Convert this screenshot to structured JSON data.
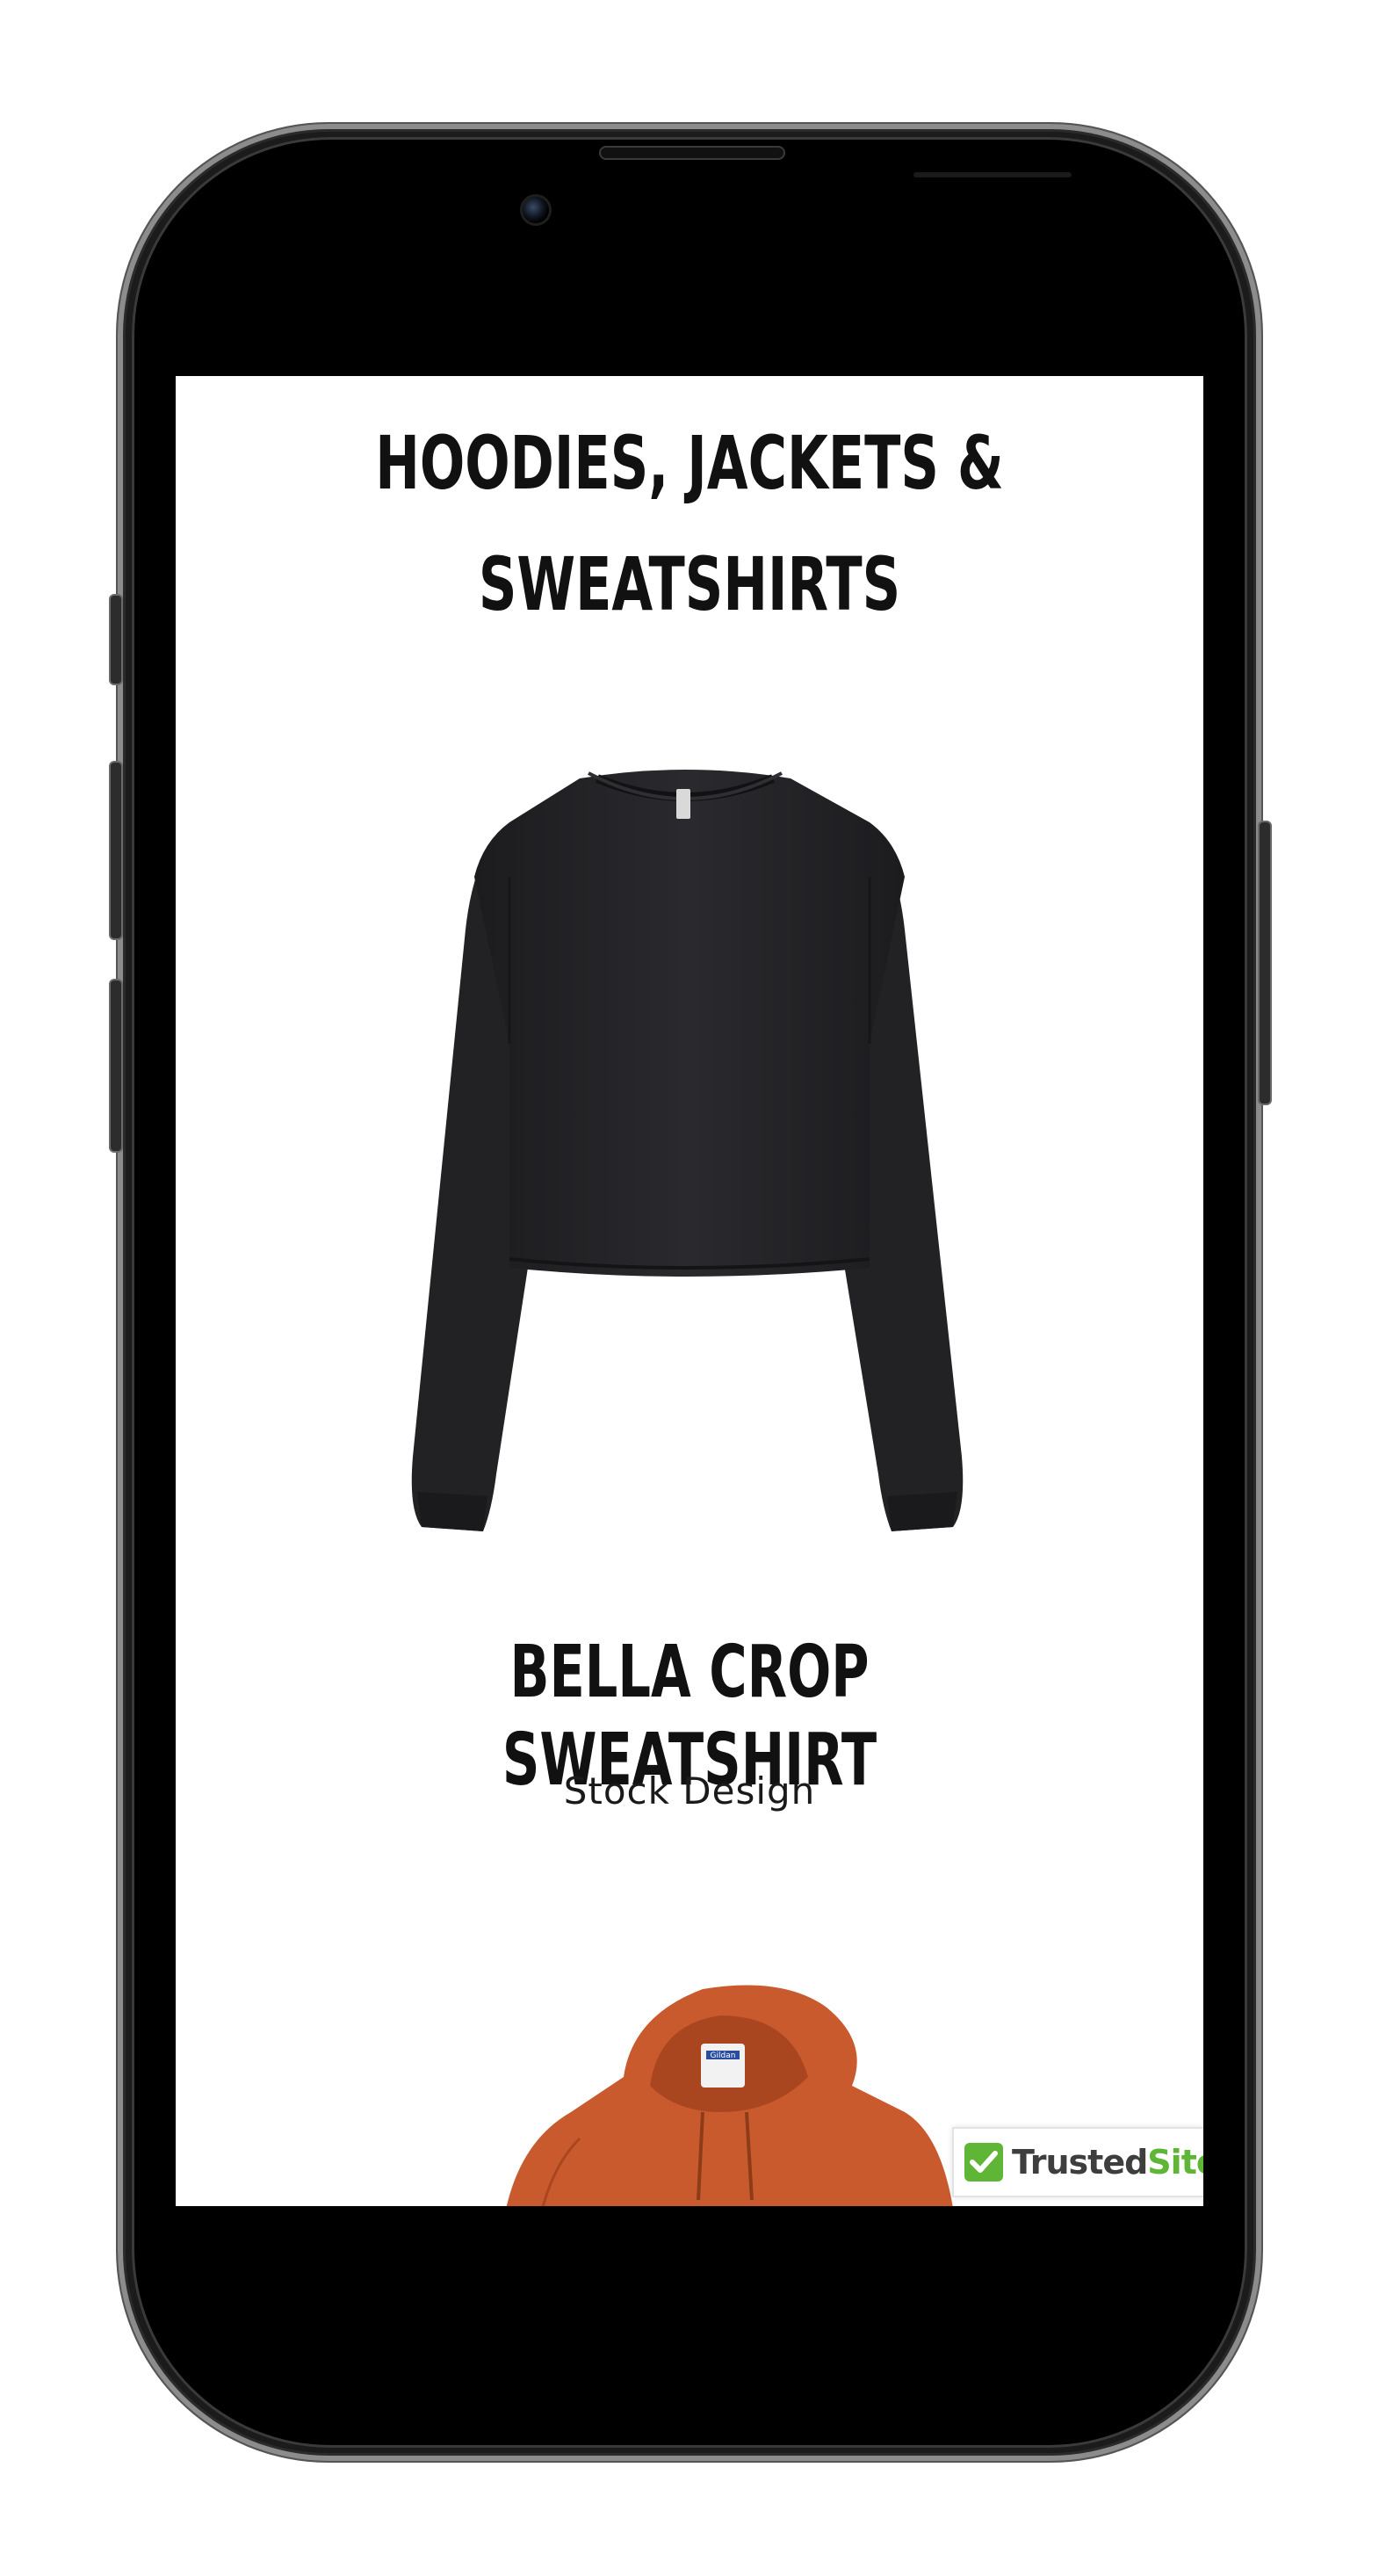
{
  "page": {
    "title_line1": "HOODIES, JACKETS &",
    "title_line2": "SWEATSHIRTS"
  },
  "product": {
    "title": "BELLA CROP SWEATSHIRT",
    "subtitle": "Stock Design",
    "image": "black-crop-sweatshirt",
    "image_color": "#222225"
  },
  "next_product": {
    "image": "orange-hoodie",
    "image_color": "#c85a2e",
    "tag_text": "Gildan"
  },
  "badge": {
    "brand": "Trusted",
    "brand_accent": "Site",
    "trademark": "™",
    "icon": "check-icon",
    "accent_color": "#5fb636"
  }
}
